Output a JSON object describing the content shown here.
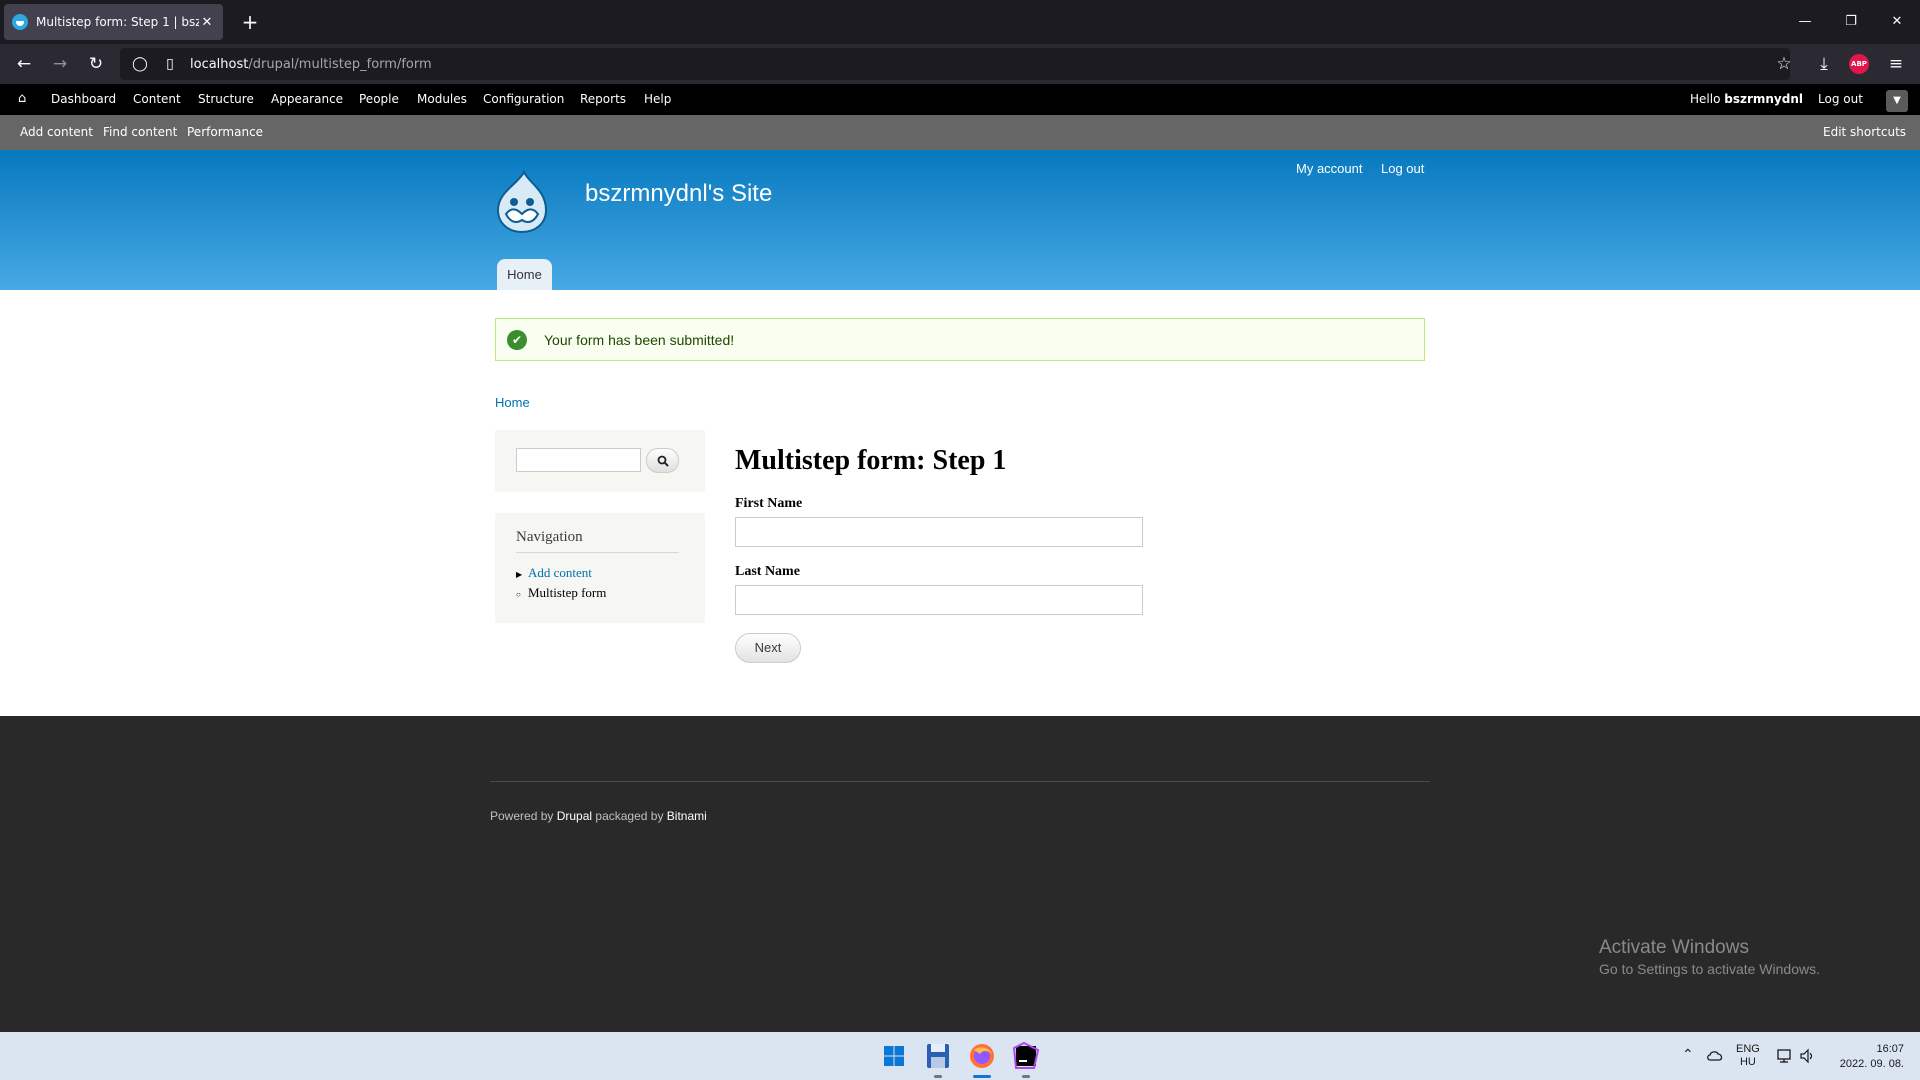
{
  "browser": {
    "tab_title": "Multistep form: Step 1 | bszrmnydnl's Site",
    "tab_close": "✕",
    "new_tab": "+",
    "url_host": "localhost",
    "url_path": "/drupal/multistep_form/form",
    "adblock_label": "ABP"
  },
  "toolbar": {
    "menu": [
      "Dashboard",
      "Content",
      "Structure",
      "Appearance",
      "People",
      "Modules",
      "Configuration",
      "Reports",
      "Help"
    ],
    "hello_prefix": "Hello ",
    "username": "bszrmnydnl",
    "logout": "Log out"
  },
  "shortcuts": {
    "items": [
      "Add content",
      "Find content",
      "Performance"
    ],
    "edit": "Edit shortcuts"
  },
  "header": {
    "site_name": "bszrmnydnl's Site",
    "secondary_menu": [
      "My account",
      "Log out"
    ],
    "main_menu": [
      "Home"
    ]
  },
  "messages": {
    "status": "Your form has been submitted!"
  },
  "breadcrumb": [
    "Home"
  ],
  "sidebar": {
    "navigation_title": "Navigation",
    "items": [
      {
        "label": "Add content"
      },
      {
        "label": "Multistep form"
      }
    ]
  },
  "main": {
    "title": "Multistep form: Step 1",
    "fields": [
      {
        "label": "First Name",
        "value": ""
      },
      {
        "label": "Last Name",
        "value": ""
      }
    ],
    "next_button": "Next"
  },
  "footer": {
    "powered_pre": "Powered by ",
    "drupal": "Drupal",
    "packaged": " packaged by ",
    "bitnami": "Bitnami"
  },
  "watermark": {
    "title": "Activate Windows",
    "subtitle": "Go to Settings to activate Windows."
  },
  "system_tray": {
    "lang_1": "ENG",
    "lang_2": "HU",
    "time": "16:07",
    "date": "2022. 09. 08."
  },
  "colors": {
    "link": "#0071b3",
    "header_top": "#0779bf",
    "header_bottom": "#48a9e4",
    "status_bg": "#f8fff0"
  }
}
